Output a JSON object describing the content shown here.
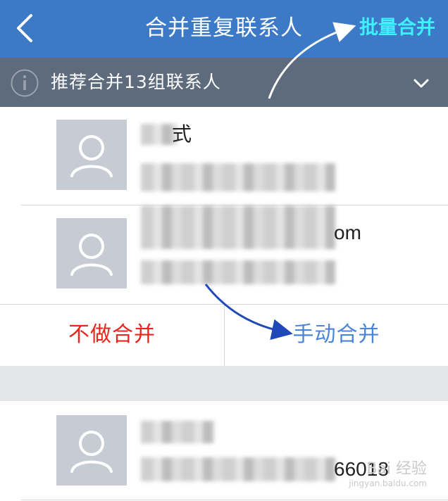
{
  "header": {
    "title": "合并重复联系人",
    "batch_merge_label": "批量合并",
    "back_icon": "chevron-left-icon"
  },
  "info_bar": {
    "text": "推荐合并13组联系人",
    "info_icon": "info-circle-icon",
    "expand_icon": "chevron-down-icon"
  },
  "group1": {
    "contact1": {
      "name_fragment": "式",
      "line2_fragment": ""
    },
    "contact2": {
      "line1_fragment": "om"
    }
  },
  "actions": {
    "skip_label": "不做合并",
    "manual_label": "手动合并"
  },
  "group2": {
    "contact1": {
      "line2_fragment": "66018"
    }
  },
  "watermark": {
    "brand": "Bai 经验",
    "url": "jingyan.baidu.com"
  },
  "colors": {
    "navbar": "#3c7ac8",
    "info_bar": "#5d6b7d",
    "batch_merge": "#3ff0ff",
    "skip": "#e8261d",
    "manual": "#4b86d6",
    "annotation_arrow": "#1f49b8"
  }
}
